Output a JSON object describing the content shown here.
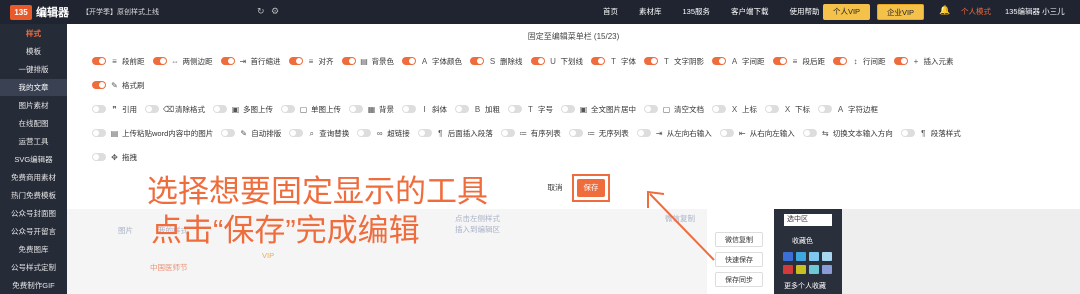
{
  "topbar": {
    "logo_badge": "135",
    "logo_name": "编辑器",
    "promo": "【开学季】原创样式上线",
    "nav": [
      "首页",
      "素材库",
      "135服务",
      "客户端下载",
      "使用帮助"
    ],
    "vip_personal": "个人VIP",
    "vip_enterprise": "企业VIP",
    "mode": "个人模式",
    "user": "135编辑器 小三儿"
  },
  "sidebar": {
    "items": [
      "样式",
      "模板",
      "一键排版",
      "我的文章",
      "图片素材",
      "在线配图",
      "运营工具",
      "SVG编辑器",
      "免费商用素材",
      "热门免费模板",
      "公众号封面图",
      "公众号开留言",
      "免费图库",
      "公号样式定制",
      "免费制作GIF"
    ]
  },
  "panel": {
    "title": "固定至编辑菜单栏 (15/23)",
    "rows": [
      [
        {
          "label": "段前距",
          "on": true,
          "icon": "paragraph-before-icon"
        },
        {
          "label": "两侧边距",
          "on": true,
          "icon": "side-margin-icon"
        },
        {
          "label": "首行缩进",
          "on": true,
          "icon": "indent-icon"
        },
        {
          "label": "对齐",
          "on": true,
          "icon": "align-icon"
        },
        {
          "label": "背景色",
          "on": true,
          "icon": "background-color-icon"
        },
        {
          "label": "字体颜色",
          "on": true,
          "icon": "font-color-icon"
        },
        {
          "label": "删除线",
          "on": true,
          "icon": "strikethrough-icon"
        },
        {
          "label": "下划线",
          "on": true,
          "icon": "underline-icon"
        },
        {
          "label": "字体",
          "on": true,
          "icon": "font-icon"
        },
        {
          "label": "文字阴影",
          "on": true,
          "icon": "text-shadow-icon"
        },
        {
          "label": "字间距",
          "on": true,
          "icon": "letter-spacing-icon"
        },
        {
          "label": "段后距",
          "on": true,
          "icon": "paragraph-after-icon"
        },
        {
          "label": "行间距",
          "on": true,
          "icon": "line-height-icon"
        },
        {
          "label": "插入元素",
          "on": true,
          "icon": "insert-element-icon"
        }
      ],
      [
        {
          "label": "格式刷",
          "on": true,
          "icon": "format-painter-icon"
        }
      ],
      [
        {
          "label": "引用",
          "on": false,
          "icon": "quote-icon"
        },
        {
          "label": "清除格式",
          "on": false,
          "icon": "clear-format-icon"
        },
        {
          "label": "多图上传",
          "on": false,
          "icon": "multi-image-upload-icon"
        },
        {
          "label": "单图上传",
          "on": false,
          "icon": "single-image-upload-icon"
        },
        {
          "label": "背景",
          "on": false,
          "icon": "background-icon"
        },
        {
          "label": "斜体",
          "on": false,
          "icon": "italic-icon"
        },
        {
          "label": "加粗",
          "on": false,
          "icon": "bold-icon"
        },
        {
          "label": "字号",
          "on": false,
          "icon": "font-size-icon"
        },
        {
          "label": "全文图片居中",
          "on": false,
          "icon": "center-images-icon"
        },
        {
          "label": "清空文档",
          "on": false,
          "icon": "clear-document-icon"
        },
        {
          "label": "上标",
          "on": false,
          "icon": "superscript-icon"
        },
        {
          "label": "下标",
          "on": false,
          "icon": "subscript-icon"
        },
        {
          "label": "字符边框",
          "on": false,
          "icon": "character-border-icon"
        }
      ],
      [
        {
          "label": "上传粘贴word内容中的图片",
          "on": false,
          "icon": "upload-word-images-icon"
        },
        {
          "label": "自动排版",
          "on": false,
          "icon": "auto-format-icon"
        },
        {
          "label": "查询替换",
          "on": false,
          "icon": "search-replace-icon"
        },
        {
          "label": "超链接",
          "on": false,
          "icon": "link-icon"
        },
        {
          "label": "后面插入段落",
          "on": false,
          "icon": "insert-paragraph-after-icon"
        },
        {
          "label": "有序列表",
          "on": false,
          "icon": "ordered-list-icon"
        },
        {
          "label": "无序列表",
          "on": false,
          "icon": "unordered-list-icon"
        },
        {
          "label": "从左向右输入",
          "on": false,
          "icon": "ltr-icon"
        },
        {
          "label": "从右向左输入",
          "on": false,
          "icon": "rtl-icon"
        },
        {
          "label": "切换文本输入方向",
          "on": false,
          "icon": "toggle-direction-icon"
        },
        {
          "label": "段落样式",
          "on": false,
          "icon": "paragraph-style-icon"
        }
      ],
      [
        {
          "label": "拖拽",
          "on": false,
          "icon": "drag-icon"
        }
      ]
    ],
    "cancel": "取消",
    "save": "保存"
  },
  "annotation": {
    "line1": "选择想要固定显示的工具",
    "line2": "点击“保存”完成编辑",
    "color": "#ef6c3d"
  },
  "background": {
    "faint_texts": [
      "图片",
      "我的样式",
      "VIP",
      "中国医师节",
      "点击左侧样式",
      "插入到编辑区",
      "微信复制"
    ],
    "tool_buttons": [
      "微信复制",
      "快速保存",
      "保存同步"
    ],
    "region_select": "选中区",
    "colors_label": "收藏色",
    "swatches": [
      "#3b6fd6",
      "#3fa7e0",
      "#7fc7f0",
      "#a8d8f0",
      "#d33b3b",
      "#c8c020",
      "#6fc7d6",
      "#8a9cd8"
    ],
    "more_favorites": "更多个人收藏"
  }
}
